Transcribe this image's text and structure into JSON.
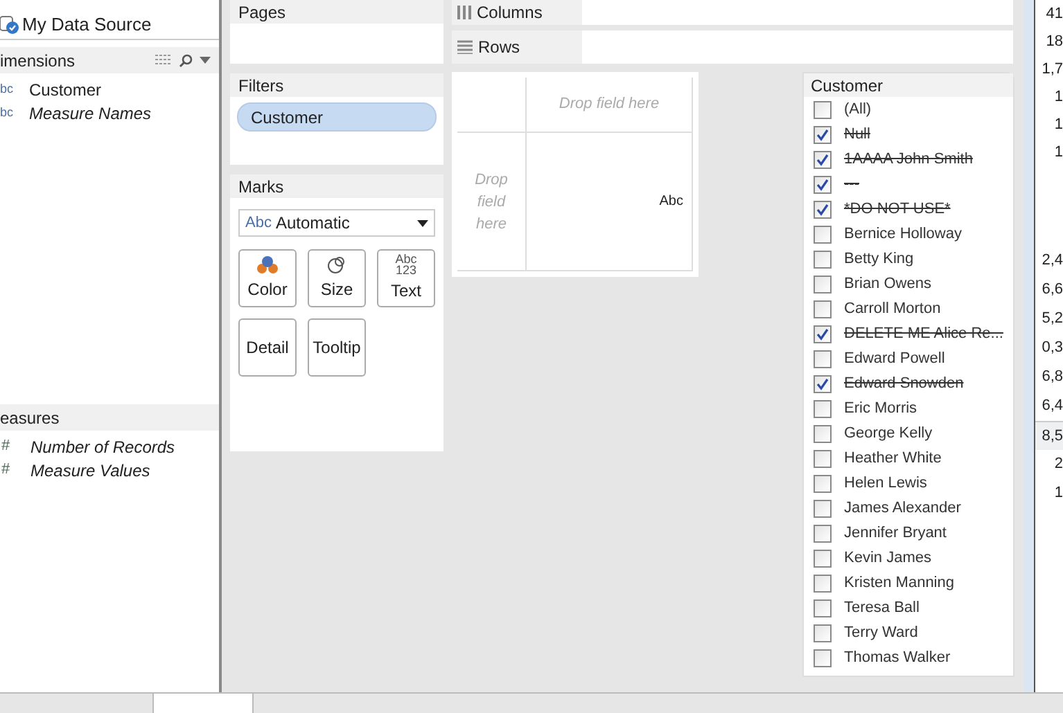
{
  "data_source": {
    "name": "My Data Source"
  },
  "dimensions": {
    "title": "imensions",
    "items": [
      {
        "icon": "bc",
        "label": "Customer",
        "italic": false
      },
      {
        "icon": "bc",
        "label": "Measure Names",
        "italic": true
      }
    ]
  },
  "measures": {
    "title": "easures",
    "items": [
      {
        "icon": "#",
        "label": "Number of Records"
      },
      {
        "icon": "#",
        "label": "Measure Values"
      }
    ]
  },
  "pages": {
    "title": "Pages"
  },
  "filters": {
    "title": "Filters",
    "pills": [
      "Customer"
    ]
  },
  "marks": {
    "title": "Marks",
    "type_icon": "Abc",
    "type": "Automatic",
    "buttons": [
      {
        "kind": "color",
        "label": "Color"
      },
      {
        "kind": "size",
        "label": "Size"
      },
      {
        "kind": "text",
        "label": "Text",
        "icon_text": "Abc\n123"
      },
      {
        "kind": "detail",
        "label": "Detail"
      },
      {
        "kind": "tooltip",
        "label": "Tooltip"
      }
    ]
  },
  "columns_shelf": {
    "title": "Columns"
  },
  "rows_shelf": {
    "title": "Rows"
  },
  "view": {
    "top_drop": "Drop field here",
    "left_drop": "Drop field here",
    "cell": "Abc"
  },
  "filter_card": {
    "title": "Customer",
    "items": [
      {
        "label": "(All)",
        "checked": false
      },
      {
        "label": "Null",
        "checked": true
      },
      {
        "label": "1AAAA John Smith",
        "checked": true
      },
      {
        "label": "---",
        "checked": true
      },
      {
        "label": "*DO NOT USE*",
        "checked": true
      },
      {
        "label": "Bernice Holloway",
        "checked": false
      },
      {
        "label": "Betty King",
        "checked": false
      },
      {
        "label": "Brian Owens",
        "checked": false
      },
      {
        "label": "Carroll Morton",
        "checked": false
      },
      {
        "label": "DELETE ME Alice Re...",
        "checked": true
      },
      {
        "label": "Edward Powell",
        "checked": false
      },
      {
        "label": "Edward Snowden",
        "checked": true
      },
      {
        "label": "Eric Morris",
        "checked": false
      },
      {
        "label": "George Kelly",
        "checked": false
      },
      {
        "label": "Heather White",
        "checked": false
      },
      {
        "label": "Helen Lewis",
        "checked": false
      },
      {
        "label": "James Alexander",
        "checked": false
      },
      {
        "label": "Jennifer Bryant",
        "checked": false
      },
      {
        "label": "Kevin James",
        "checked": false
      },
      {
        "label": "Kristen Manning",
        "checked": false
      },
      {
        "label": "Teresa Ball",
        "checked": false
      },
      {
        "label": "Terry Ward",
        "checked": false
      },
      {
        "label": "Thomas Walker",
        "checked": false
      }
    ]
  },
  "column_3": {
    "upper": [
      "41",
      "18",
      "1,7",
      "1",
      "1",
      "1"
    ],
    "lower": [
      {
        "text": "2,4",
        "selected": false
      },
      {
        "text": "6,6",
        "selected": false
      },
      {
        "text": "5,2",
        "selected": false
      },
      {
        "text": "0,3",
        "selected": false
      },
      {
        "text": "6,8",
        "selected": false
      },
      {
        "text": "6,4",
        "selected": false
      },
      {
        "text": "8,5",
        "selected": true
      },
      {
        "text": "2",
        "selected": false
      },
      {
        "text": "1",
        "selected": false
      }
    ]
  }
}
